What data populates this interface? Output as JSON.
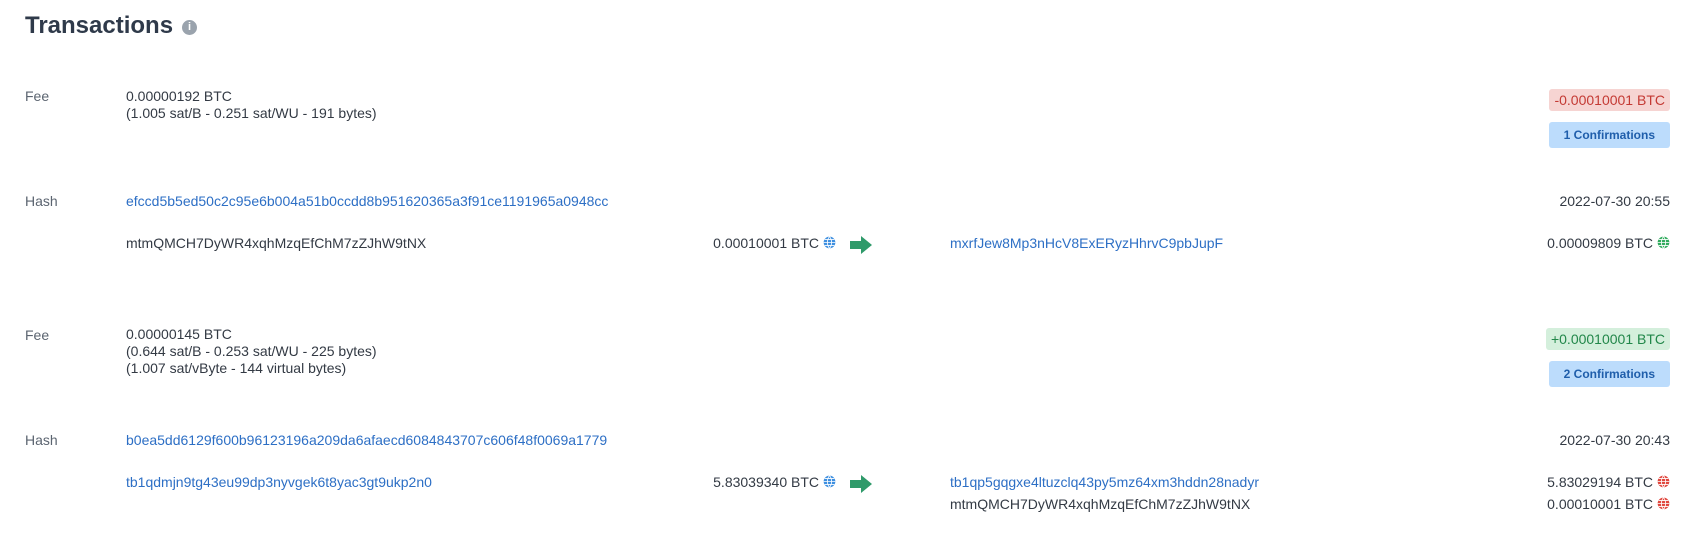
{
  "header": {
    "title": "Transactions",
    "info_icon": "i"
  },
  "colors": {
    "accent": "#2d6fc5",
    "negative": "#c43a34",
    "positive": "#22874a",
    "arrow": "#2f9a6a"
  },
  "transactions": [
    {
      "fee_label": "Fee",
      "fee_value": "0.00000192 BTC",
      "fee_lines": [
        "(1.005 sat/B - 0.251 sat/WU - 191 bytes)"
      ],
      "amount_badge": "-0.00010001 BTC",
      "amount_sign": "negative",
      "confirmations": "1 Confirmations",
      "hash_label": "Hash",
      "hash": "efccd5b5ed50c2c95e6b004a51b0ccdd8b951620365a3f91ce1191965a0948cc",
      "timestamp": "2022-07-30 20:55",
      "input_address": "mtmQMCH7DyWR4xqhMzqEfChM7zZJhW9tNX",
      "input_amount": "0.00010001 BTC",
      "outputs": [
        {
          "address": "mxrfJew8Mp3nHcV8ExERyzHhrvC9pbJupF",
          "amount": "0.00009809 BTC",
          "is_link": true,
          "globe": "green"
        }
      ]
    },
    {
      "fee_label": "Fee",
      "fee_value": "0.00000145 BTC",
      "fee_lines": [
        "(0.644 sat/B - 0.253 sat/WU - 225 bytes)",
        "(1.007 sat/vByte - 144 virtual bytes)"
      ],
      "amount_badge": "+0.00010001 BTC",
      "amount_sign": "positive",
      "confirmations": "2 Confirmations",
      "hash_label": "Hash",
      "hash": "b0ea5dd6129f600b96123196a209da6afaecd6084843707c606f48f0069a1779",
      "timestamp": "2022-07-30 20:43",
      "input_address": "tb1qdmjn9tg43eu99dp3nyvgek6t8yac3gt9ukp2n0",
      "input_amount": "5.83039340 BTC",
      "outputs": [
        {
          "address": "tb1qp5gqgxe4ltuzclq43py5mz64xm3hddn28nadyr",
          "amount": "5.83029194 BTC",
          "is_link": true,
          "globe": "red"
        },
        {
          "address": "mtmQMCH7DyWR4xqhMzqEfChM7zZJhW9tNX",
          "amount": "0.00010001 BTC",
          "is_link": false,
          "globe": "red"
        }
      ]
    }
  ]
}
